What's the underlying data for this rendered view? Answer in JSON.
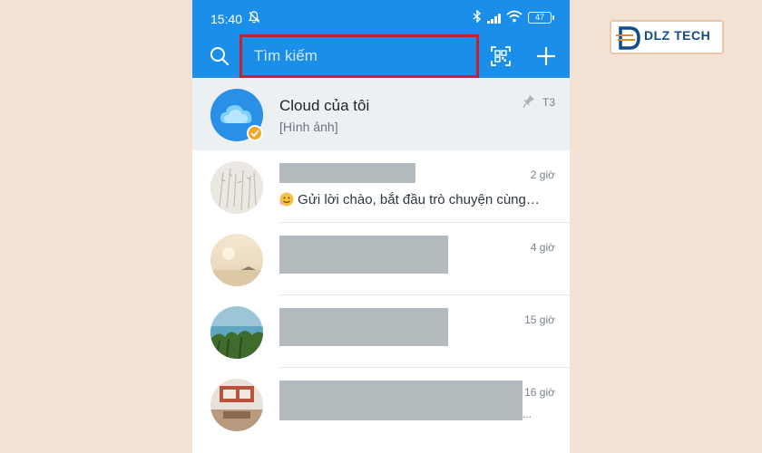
{
  "status_bar": {
    "time": "15:40",
    "battery": "47"
  },
  "header": {
    "search_placeholder": "Tìm kiếm"
  },
  "conversations": [
    {
      "name": "Cloud của tôi",
      "preview": "[Hình ảnh]",
      "time": "T3",
      "pinned": true
    },
    {
      "preview": "Gửi lời chào, bắt đầu trò chuyện cùng…",
      "time": "2 giờ"
    },
    {
      "time": "4 giờ"
    },
    {
      "time": "15 giờ"
    },
    {
      "time": "16 giờ",
      "trailing": "..."
    }
  ],
  "watermark": {
    "brand": "DLZ TECH"
  },
  "colors": {
    "primary": "#1a8ee8",
    "highlight_border": "#c8202f",
    "background": "#f3e2d3"
  },
  "icons": [
    "bell-off-icon",
    "bluetooth-icon",
    "signal-icon",
    "wifi-icon",
    "battery-icon",
    "search-icon",
    "qr-scan-icon",
    "plus-icon",
    "pin-icon",
    "cloud-icon",
    "verified-icon",
    "emoji-icon"
  ]
}
